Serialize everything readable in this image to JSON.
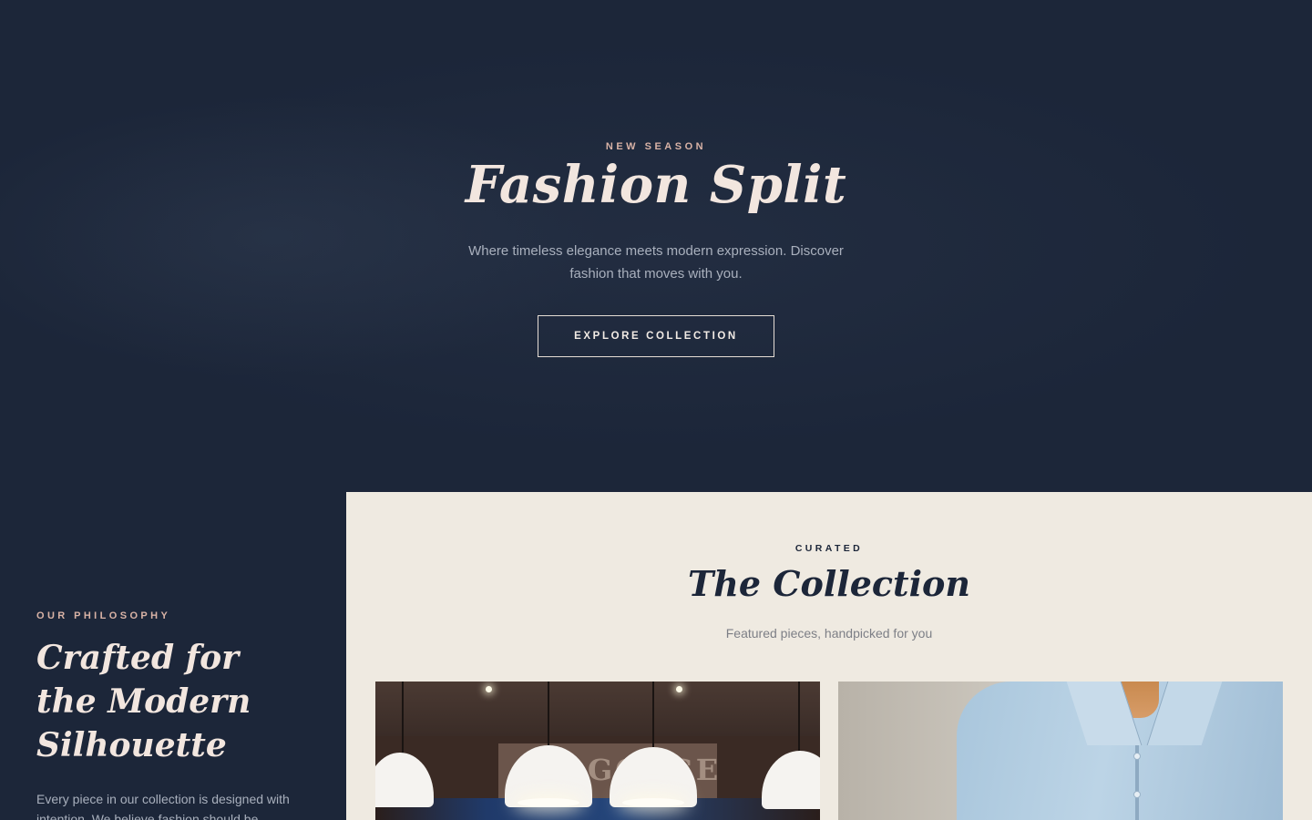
{
  "hero": {
    "eyebrow": "NEW SEASON",
    "title": "Fashion Split",
    "subtitle": "Where timeless elegance meets modern expression. Discover fashion that moves with you.",
    "cta_label": "EXPLORE COLLECTION"
  },
  "philosophy": {
    "eyebrow": "OUR PHILOSOPHY",
    "title": "Crafted for the Modern Silhouette",
    "body": "Every piece in our collection is designed with intention. We believe fashion should be"
  },
  "collection": {
    "eyebrow": "CURATED",
    "title": "The Collection",
    "subtitle": "Featured pieces, handpicked for you",
    "cards": [
      {
        "image": "boutique-interior-lamps-image",
        "banner_text": "BAGGAGE"
      },
      {
        "image": "light-blue-shirt-image"
      }
    ]
  },
  "colors": {
    "navy": "#1c2639",
    "cream": "#efeae1",
    "accent_pink": "#d9b3a6",
    "text_light": "#f2e6df"
  }
}
